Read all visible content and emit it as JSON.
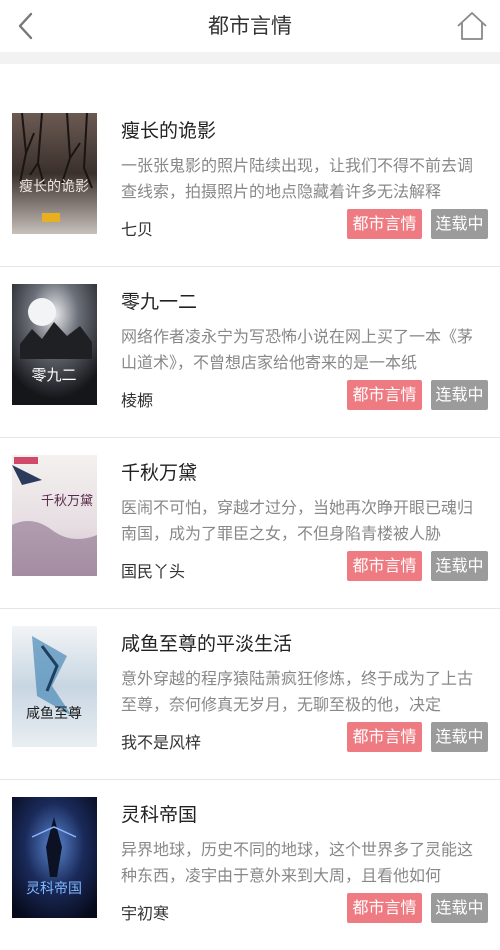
{
  "header": {
    "title": "都市言情",
    "back_icon": "chevron-left-icon",
    "home_icon": "home-icon"
  },
  "colors": {
    "category_tag": "#ef7b82",
    "status_tag": "#9b9b9b",
    "section_gap": "#f2f2f2"
  },
  "books": [
    {
      "title": "瘦长的诡影",
      "description": "一张张鬼影的照片陆续出现，让我们不得不前去调查线索，拍摄照片的地点隐藏着许多无法解释",
      "author": "七贝",
      "category": "都市言情",
      "status": "连载中",
      "cover_text": "瘦长的诡影"
    },
    {
      "title": "零九一二",
      "description": "网络作者凌永宁为写恐怖小说在网上买了一本《茅山道术》，不曾想店家给他寄来的是一本纸",
      "author": "棱榞",
      "category": "都市言情",
      "status": "连载中",
      "cover_text": "零九二"
    },
    {
      "title": "千秋万黛",
      "description": "医闹不可怕，穿越才过分，当她再次睁开眼已魂归南国，成为了罪臣之女，不但身陷青楼被人胁",
      "author": "国民丫头",
      "category": "都市言情",
      "status": "连载中",
      "cover_text": "千秋万黛"
    },
    {
      "title": "咸鱼至尊的平淡生活",
      "description": "意外穿越的程序猿陆萧疯狂修炼，终于成为了上古至尊，奈何修真无岁月，无聊至极的他，决定",
      "author": "我不是风梓",
      "category": "都市言情",
      "status": "连载中",
      "cover_text": "咸鱼至尊"
    },
    {
      "title": "灵科帝国",
      "description": "异界地球，历史不同的地球，这个世界多了灵能这种东西，凌宇由于意外来到大周，且看他如何",
      "author": "宇初寒",
      "category": "都市言情",
      "status": "连载中",
      "cover_text": "灵科帝国"
    }
  ]
}
